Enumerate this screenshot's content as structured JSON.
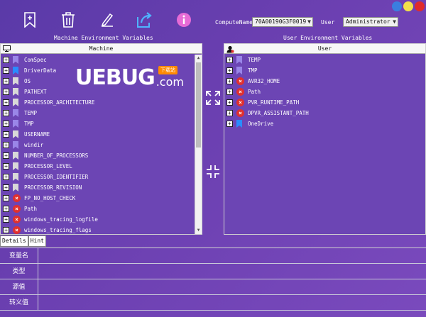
{
  "toolbar": {
    "buttons": [
      {
        "name": "add-bookmark-icon"
      },
      {
        "name": "delete-icon"
      },
      {
        "name": "edit-icon"
      },
      {
        "name": "export-icon"
      },
      {
        "name": "info-icon"
      }
    ],
    "compute_label": "ComputeName",
    "compute_value": "70A00190G3F0019",
    "user_label": "User",
    "user_value": "Administrator"
  },
  "window_buttons": [
    "#3a7ee0",
    "#f2e14a",
    "#e02b2b"
  ],
  "machine_section_title": "Machine Environment Variables",
  "user_section_title": "User Environment Variables",
  "machine_panel": {
    "header": "Machine",
    "rows": [
      {
        "label": "ComSpec",
        "icon": "bookmark",
        "color": "#9a86e8"
      },
      {
        "label": "DriverData",
        "icon": "bookmark",
        "color": "#2a8cff"
      },
      {
        "label": "OS",
        "icon": "bookmark",
        "color": "#d8d8d8"
      },
      {
        "label": "PATHEXT",
        "icon": "bookmark",
        "color": "#d8d8d8"
      },
      {
        "label": "PROCESSOR_ARCHITECTURE",
        "icon": "bookmark",
        "color": "#d8d8d8"
      },
      {
        "label": "TEMP",
        "icon": "bookmark",
        "color": "#9a86e8"
      },
      {
        "label": "TMP",
        "icon": "bookmark",
        "color": "#9a86e8"
      },
      {
        "label": "USERNAME",
        "icon": "bookmark",
        "color": "#d8d8d8"
      },
      {
        "label": "windir",
        "icon": "bookmark",
        "color": "#9a86e8"
      },
      {
        "label": "NUMBER_OF_PROCESSORS",
        "icon": "bookmark",
        "color": "#d8d8d8"
      },
      {
        "label": "PROCESSOR_LEVEL",
        "icon": "bookmark",
        "color": "#d8d8d8"
      },
      {
        "label": "PROCESSOR_IDENTIFIER",
        "icon": "bookmark",
        "color": "#d8d8d8"
      },
      {
        "label": "PROCESSOR_REVISION",
        "icon": "bookmark",
        "color": "#d8d8d8"
      },
      {
        "label": "FP_NO_HOST_CHECK",
        "icon": "error",
        "color": "#e0302f"
      },
      {
        "label": "Path",
        "icon": "error",
        "color": "#e0302f"
      },
      {
        "label": "windows_tracing_logfile",
        "icon": "error",
        "color": "#e0302f"
      },
      {
        "label": "windows_tracing_flags",
        "icon": "error",
        "color": "#e0302f"
      }
    ]
  },
  "user_panel": {
    "header": "User",
    "rows": [
      {
        "label": "TEMP",
        "icon": "bookmark",
        "color": "#9a86e8"
      },
      {
        "label": "TMP",
        "icon": "bookmark",
        "color": "#9a86e8"
      },
      {
        "label": "AVR32_HOME",
        "icon": "error",
        "color": "#e0302f"
      },
      {
        "label": "Path",
        "icon": "error",
        "color": "#e0302f"
      },
      {
        "label": "PVR_RUNTIME_PATH",
        "icon": "error",
        "color": "#e0302f"
      },
      {
        "label": "DPVR_ASSISTANT_PATH",
        "icon": "error",
        "color": "#e0302f"
      },
      {
        "label": "OneDrive",
        "icon": "bookmark",
        "color": "#2a8cff"
      }
    ]
  },
  "watermark": {
    "main": "UEBUG",
    "com": ".com",
    "badge": "下载站"
  },
  "tabs": [
    "Details",
    "Hint"
  ],
  "details_rows": [
    {
      "label": "变量名",
      "value": ""
    },
    {
      "label": "类型",
      "value": ""
    },
    {
      "label": "源值",
      "value": ""
    },
    {
      "label": "转义值",
      "value": ""
    }
  ]
}
